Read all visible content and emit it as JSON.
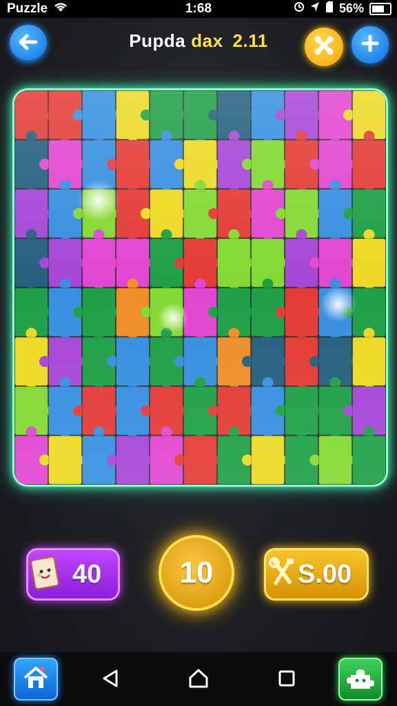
{
  "status_bar": {
    "app_name": "Puzzle",
    "time": "1:68",
    "battery": "56%"
  },
  "header": {
    "title_part1": "Pupda",
    "title_part2": "dax",
    "title_part3": "2.11"
  },
  "icons": {
    "back": "arrow-left-icon",
    "tool": "crossed-tools-icon",
    "add": "plus-icon",
    "hint": "card-character-icon",
    "coins": "tools-icon",
    "home": "home-icon",
    "back_nav": "triangle-back-icon",
    "home_nav": "house-outline-icon",
    "recent": "square-recent-icon",
    "puzzle": "puzzle-piece-icon"
  },
  "counters": {
    "hints": "40",
    "level": "10",
    "coins": "S.00"
  },
  "board": {
    "rows": 8,
    "cols": 11,
    "colors": {
      "R": "#e2342d",
      "B": "#2f8bde",
      "G": "#169c3e",
      "L": "#7ed82a",
      "Y": "#ecd81b",
      "P": "#a33fd6",
      "M": "#e13fcf",
      "O": "#ef8a1f",
      "T": "#1b5a7a"
    },
    "grid": [
      [
        "R",
        "R",
        "B",
        "Y",
        "G",
        "G",
        "T",
        "B",
        "P",
        "M",
        "Y"
      ],
      [
        "T",
        "M",
        "B",
        "R",
        "B",
        "Y",
        "P",
        "L",
        "R",
        "M",
        "R"
      ],
      [
        "P",
        "B",
        "L",
        "R",
        "Y",
        "L",
        "R",
        "M",
        "L",
        "B",
        "G"
      ],
      [
        "T",
        "P",
        "M",
        "M",
        "G",
        "R",
        "L",
        "L",
        "P",
        "M",
        "Y"
      ],
      [
        "G",
        "B",
        "G",
        "O",
        "L",
        "M",
        "G",
        "G",
        "R",
        "B",
        "G"
      ],
      [
        "Y",
        "P",
        "G",
        "B",
        "G",
        "B",
        "O",
        "T",
        "R",
        "T",
        "Y"
      ],
      [
        "L",
        "B",
        "R",
        "B",
        "R",
        "G",
        "R",
        "B",
        "G",
        "G",
        "P"
      ],
      [
        "M",
        "Y",
        "B",
        "P",
        "M",
        "R",
        "G",
        "Y",
        "G",
        "L",
        "G"
      ]
    ]
  },
  "accent_colors": {
    "board_glow": "#3dffb5",
    "blue_button": "#0a6fe0",
    "gold": "#f4a40a",
    "purple": "#c046ff"
  }
}
